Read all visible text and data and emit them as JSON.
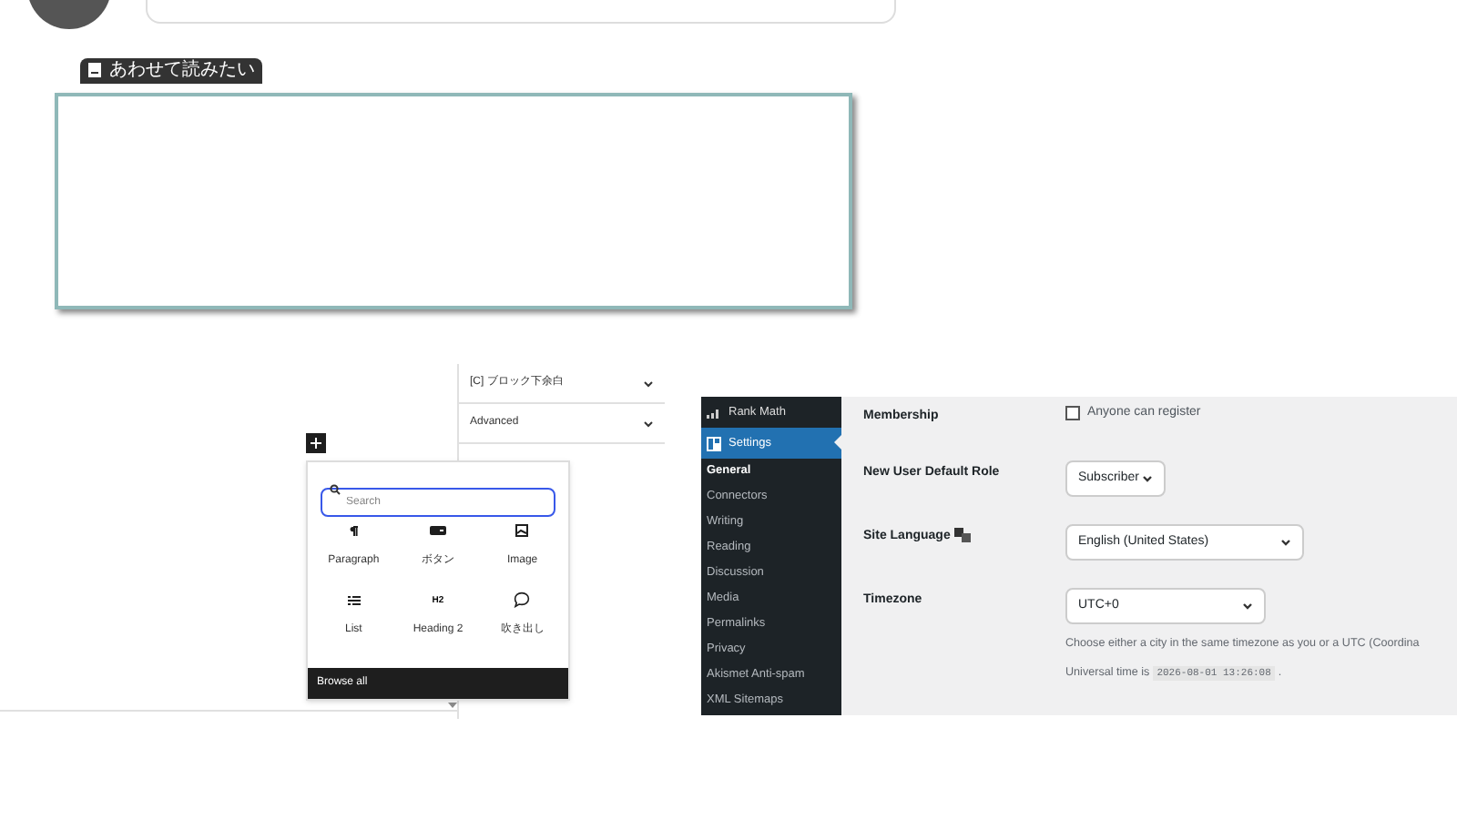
{
  "related_card": {
    "label": "あわせて読みたい"
  },
  "block_settings": {
    "panels": [
      {
        "title": "[C] ブロック下余白",
        "expanded": false
      },
      {
        "title": "Advanced",
        "expanded": false
      }
    ]
  },
  "inserter": {
    "search": {
      "placeholder": "Search"
    },
    "blocks": [
      {
        "kind": "paragraph",
        "label": "Paragraph"
      },
      {
        "kind": "button",
        "label": "ボタン"
      },
      {
        "kind": "image",
        "label": "Image"
      },
      {
        "kind": "list",
        "label": "List"
      },
      {
        "kind": "heading",
        "label": "Heading 2",
        "icon_text": "H2"
      },
      {
        "kind": "bubble",
        "label": "吹き出し"
      }
    ],
    "browse_all": "Browse all"
  },
  "admin_sidebar": {
    "items": [
      {
        "label": "Rank Math",
        "kind": "chart",
        "selected": false
      },
      {
        "label": "Settings",
        "kind": "settings",
        "selected": true
      }
    ],
    "submenu": [
      {
        "label": "General",
        "selected": true
      },
      {
        "label": "Connectors",
        "selected": false
      },
      {
        "label": "Writing",
        "selected": false
      },
      {
        "label": "Reading",
        "selected": false
      },
      {
        "label": "Discussion",
        "selected": false
      },
      {
        "label": "Media",
        "selected": false
      },
      {
        "label": "Permalinks",
        "selected": false
      },
      {
        "label": "Privacy",
        "selected": false
      },
      {
        "label": "Akismet Anti-spam",
        "selected": false
      },
      {
        "label": "XML Sitemaps",
        "selected": false
      }
    ]
  },
  "settings": {
    "rows": [
      {
        "label": "Membership",
        "kind": "checkbox",
        "value": "Anyone can register",
        "checked": false
      },
      {
        "label": "New User Default Role",
        "kind": "select",
        "value": "Subscriber"
      },
      {
        "label": "Site Language",
        "kind": "select",
        "value": "English (United States)",
        "translate_icon": true
      },
      {
        "label": "Timezone",
        "kind": "select",
        "value": "UTC+0",
        "description": "Choose either a city in the same timezone as you or a UTC (Coordina",
        "time_label": "Universal time is",
        "time_value": "2026-08-01 13:26:08",
        "time_suffix": "."
      }
    ]
  }
}
